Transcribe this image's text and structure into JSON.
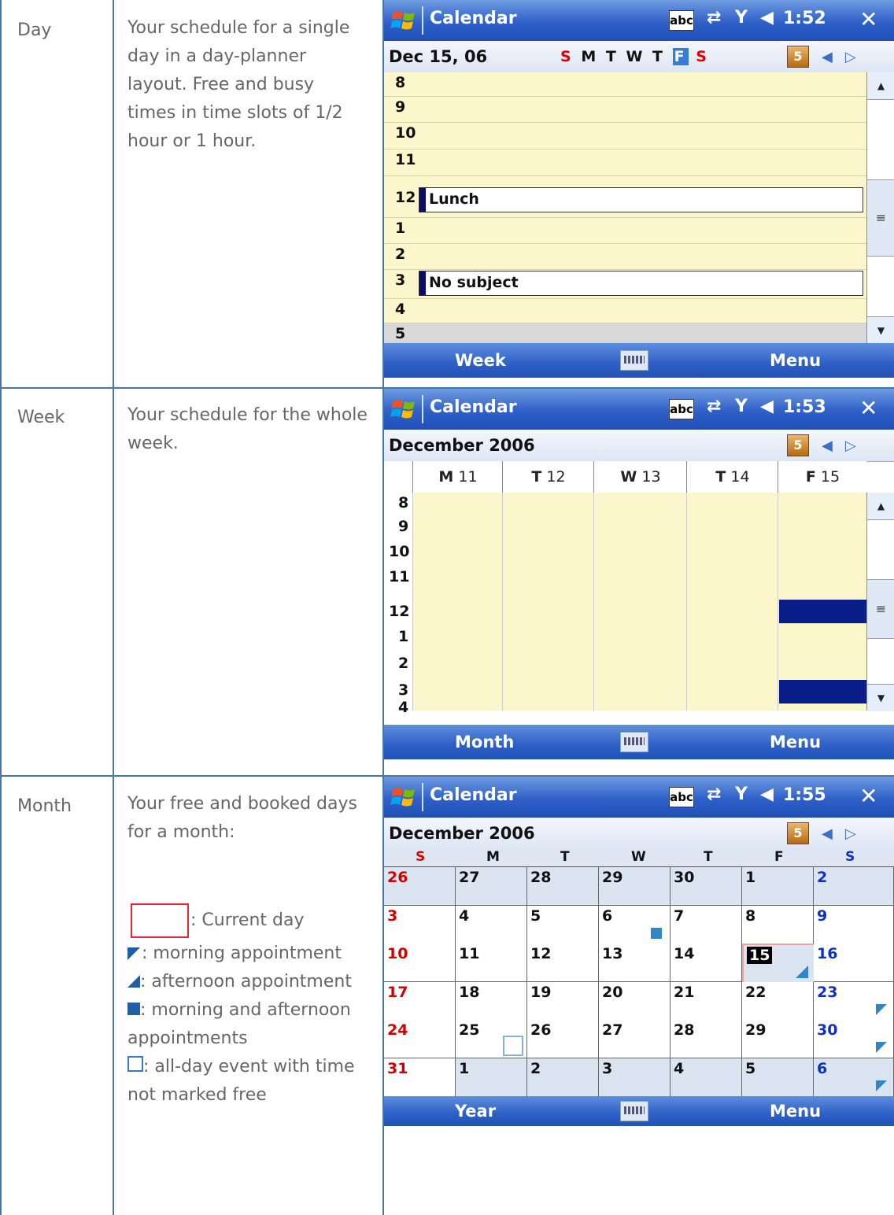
{
  "rows": [
    {
      "label": "Day",
      "description": "Your schedule for a single day in a day-planner layout. Free and busy times in time slots of 1/2 hour or 1 hour.",
      "screen": {
        "title": "Calendar",
        "time": "1:52",
        "abc": "abc",
        "subtitle": "Dec 15, 06",
        "day_letters": [
          "S",
          "M",
          "T",
          "W",
          "T",
          "F",
          "S"
        ],
        "hours": [
          "8",
          "9",
          "10",
          "11",
          "12",
          "1",
          "2",
          "3",
          "4",
          "5"
        ],
        "appointments": [
          {
            "hour": "12",
            "subject": "Lunch"
          },
          {
            "hour": "3",
            "subject": "No subject"
          }
        ],
        "menu_left": "Week",
        "menu_right": "Menu"
      }
    },
    {
      "label": "Week",
      "description": "Your schedule for the whole week.",
      "screen": {
        "title": "Calendar",
        "time": "1:53",
        "abc": "abc",
        "subtitle": "December 2006",
        "columns": [
          {
            "letter": "M",
            "num": "11"
          },
          {
            "letter": "T",
            "num": "12"
          },
          {
            "letter": "W",
            "num": "13"
          },
          {
            "letter": "T",
            "num": "14"
          },
          {
            "letter": "F",
            "num": "15"
          }
        ],
        "hours": [
          "8",
          "9",
          "10",
          "11",
          "12",
          "1",
          "2",
          "3",
          "4"
        ],
        "menu_left": "Month",
        "menu_right": "Menu"
      }
    },
    {
      "label": "Month",
      "description_top": "Your free and booked days for a month:",
      "legend": [
        {
          "symbol": "current-day",
          "text": ": Current day"
        },
        {
          "symbol": "morning",
          "text": ": morning appointment"
        },
        {
          "symbol": "afternoon",
          "text": ": afternoon appointment"
        },
        {
          "symbol": "both",
          "text": ": morning and afternoon appointments"
        },
        {
          "symbol": "allday",
          "text": ": all-day event with time not marked free"
        }
      ],
      "screen": {
        "title": "Calendar",
        "time": "1:55",
        "abc": "abc",
        "subtitle": "December 2006",
        "weekdays": [
          "S",
          "M",
          "T",
          "W",
          "T",
          "F",
          "S"
        ],
        "weeks": [
          [
            "26",
            "27",
            "28",
            "29",
            "30",
            "1",
            "2"
          ],
          [
            "3",
            "4",
            "5",
            "6",
            "7",
            "8",
            "9"
          ],
          [
            "10",
            "11",
            "12",
            "13",
            "14",
            "15",
            "16"
          ],
          [
            "17",
            "18",
            "19",
            "20",
            "21",
            "22",
            "23"
          ],
          [
            "24",
            "25",
            "26",
            "27",
            "28",
            "29",
            "30"
          ],
          [
            "31",
            "1",
            "2",
            "3",
            "4",
            "5",
            "6"
          ]
        ],
        "menu_left": "Year",
        "menu_right": "Menu"
      }
    }
  ],
  "colors": {
    "accent": "#2d5fc6",
    "planner": "#fcf6cc",
    "appointment_bar": "#0a0a6a",
    "sunday": "#d00000",
    "saturday": "#1030c0"
  }
}
